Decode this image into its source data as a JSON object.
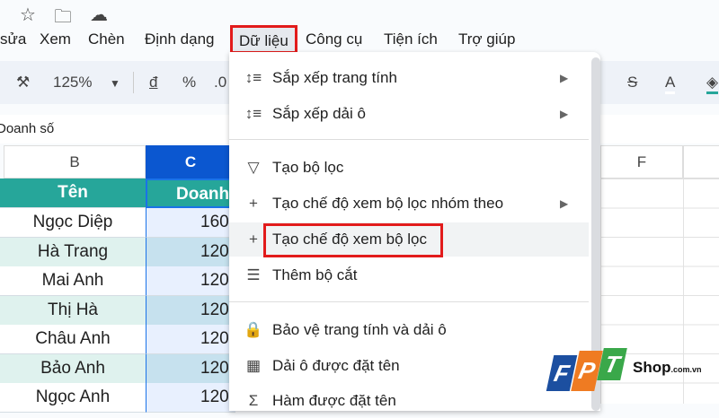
{
  "top_icons": [
    "star-icon",
    "move-to-folder-icon",
    "cloud-saved-icon"
  ],
  "menubar": {
    "items": [
      "sửa",
      "Xem",
      "Chèn",
      "Định dạng",
      "Dữ liệu",
      "Công cụ",
      "Tiện ích",
      "Trợ giúp"
    ]
  },
  "toolbar": {
    "zoom": "125%",
    "currency": "đ",
    "percent": "%",
    "decimal": ".0",
    "text_color": "A"
  },
  "formula_bar": {
    "value": "Doanh số"
  },
  "columns": [
    "B",
    "C",
    "F"
  ],
  "table": {
    "headers": [
      "Tên",
      "Doanh"
    ],
    "rows": [
      [
        "Ngọc Diệp",
        "160"
      ],
      [
        "Hà Trang",
        "120"
      ],
      [
        "Mai Anh",
        "120"
      ],
      [
        "Thị Hà",
        "120"
      ],
      [
        "Châu Anh",
        "120"
      ],
      [
        "Bảo Anh",
        "120"
      ],
      [
        "Ngọc Anh",
        "120"
      ]
    ]
  },
  "menu": {
    "items": [
      {
        "icon": "sort-icon",
        "label": "Sắp xếp trang tính",
        "submenu": true
      },
      {
        "icon": "sort-icon",
        "label": "Sắp xếp dải ô",
        "submenu": true
      },
      {
        "icon": "filter-icon",
        "label": "Tạo bộ lọc",
        "submenu": false
      },
      {
        "icon": "plus-icon",
        "label": "Tạo chế độ xem bộ lọc nhóm theo",
        "submenu": true
      },
      {
        "icon": "plus-icon",
        "label": "Tạo chế độ xem bộ lọc",
        "submenu": false
      },
      {
        "icon": "slicer-icon",
        "label": "Thêm bộ cắt",
        "submenu": false
      },
      {
        "icon": "lock-icon",
        "label": "Bảo vệ trang tính và dải ô",
        "submenu": false
      },
      {
        "icon": "named-range-icon",
        "label": "Dải ô được đặt tên",
        "submenu": false
      },
      {
        "icon": "sigma-icon",
        "label": "Hàm được đặt tên",
        "submenu": false
      }
    ]
  },
  "watermark": {
    "brand": "FPT",
    "suffix": "Shop.com.vn"
  },
  "colors": {
    "highlight": "#e21b1b",
    "header_teal": "#26a69a",
    "selected_col": "#0b57d0"
  }
}
